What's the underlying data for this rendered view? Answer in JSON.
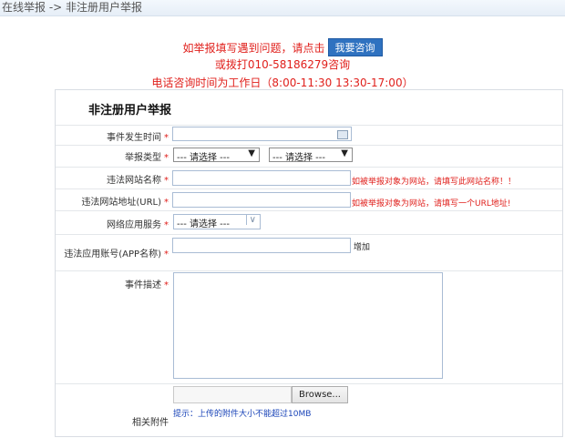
{
  "breadcrumb": "在线举报 -> 非注册用户举报",
  "notice": {
    "line1": "如举报填写遇到问题，请点击",
    "ask_button": "我要咨询",
    "line2": "或拨打010-58186279咨询",
    "line3": "电话咨询时间为工作日（8:00-11:30 13:30-17:00）"
  },
  "form": {
    "title": "非注册用户举报",
    "required_mark": "*",
    "event_time_label": "事件发生时间",
    "report_type_label": "举报类型",
    "report_type_select1": "--- 请选择 ---",
    "report_type_select2": "--- 请选择 ---",
    "site_name_label": "违法网站名称",
    "site_name_hint": "如被举报对象为网站，请填写此网站名称！！",
    "site_url_label": "违法网站地址(URL)",
    "site_url_hint": "如被举报对象为网站，请填写一个URL地址!",
    "network_service_label": "网络应用服务",
    "network_service_select": "--- 请选择 ---",
    "account_label": "违法应用账号(APP名称)",
    "add_link": "增加",
    "description_label": "事件描述",
    "attachment_label": "相关附件",
    "browse_button": "Browse...",
    "attachment_tip": "提示：上传的附件大小不能超过10MB"
  }
}
